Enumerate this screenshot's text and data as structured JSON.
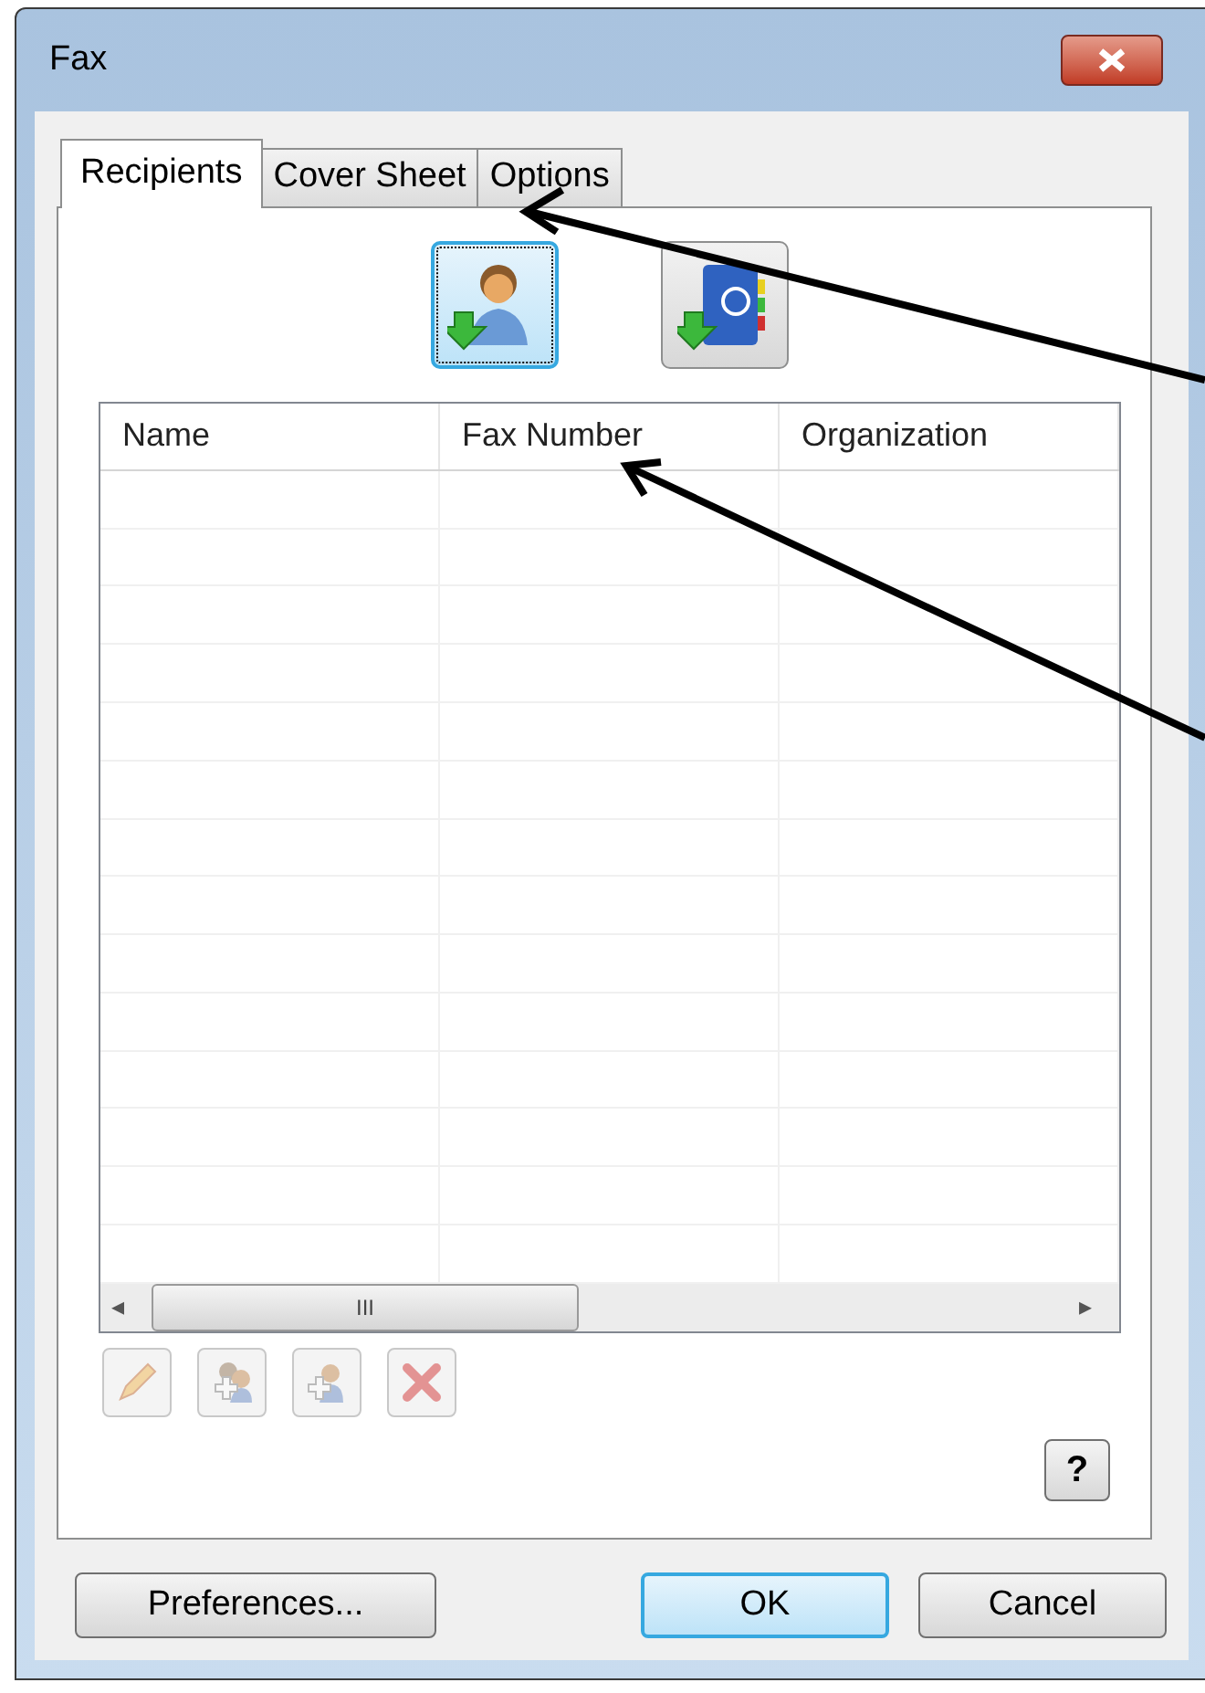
{
  "window": {
    "title": "Fax"
  },
  "tabs": [
    {
      "label": "Recipients",
      "selected": true
    },
    {
      "label": "Cover Sheet",
      "selected": false
    },
    {
      "label": "Options",
      "selected": false
    }
  ],
  "import_buttons": [
    {
      "kind": "contact",
      "focused": true
    },
    {
      "kind": "address_book",
      "focused": false
    }
  ],
  "table": {
    "columns": [
      "Name",
      "Fax Number",
      "Organization"
    ]
  },
  "scrollbar": {
    "thumb_glyph": "III",
    "left_arrow": "◂",
    "right_arrow": "▸"
  },
  "row_actions": [
    {
      "kind": "edit",
      "disabled": true
    },
    {
      "kind": "add_group",
      "disabled": true
    },
    {
      "kind": "add_person",
      "disabled": true
    },
    {
      "kind": "delete",
      "disabled": true
    }
  ],
  "help_button": "?",
  "buttons": [
    {
      "label": "Preferences...",
      "default": false
    },
    {
      "label": "OK",
      "default": true
    },
    {
      "label": "Cancel",
      "default": false
    }
  ]
}
